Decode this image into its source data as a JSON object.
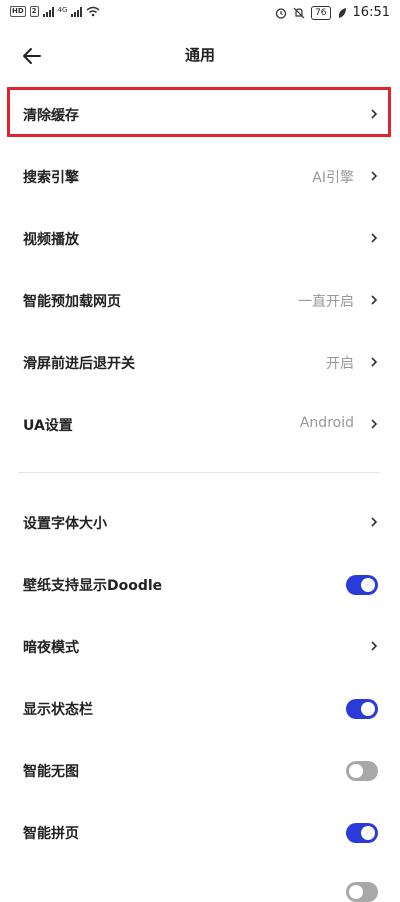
{
  "status_bar": {
    "time": "16:51",
    "battery": "76",
    "network": "4G"
  },
  "header": {
    "title": "通用"
  },
  "colors": {
    "accent": "#2b3bd8",
    "highlight": "#e0242e"
  },
  "settings_group1": [
    {
      "label": "清除缓存",
      "value": "",
      "control": "chevron"
    },
    {
      "label": "搜索引擎",
      "value": "AI引擎",
      "control": "chevron"
    },
    {
      "label": "视频播放",
      "value": "",
      "control": "chevron"
    },
    {
      "label": "智能预加载网页",
      "value": "一直开启",
      "control": "chevron"
    },
    {
      "label": "滑屏前进后退开关",
      "value": "开启",
      "control": "chevron"
    },
    {
      "label": "UA设置",
      "value": "Android",
      "control": "chevron"
    }
  ],
  "settings_group2": [
    {
      "label": "设置字体大小",
      "control": "chevron"
    },
    {
      "label": "壁纸支持显示Doodle",
      "control": "toggle",
      "on": true
    },
    {
      "label": "暗夜模式",
      "control": "chevron"
    },
    {
      "label": "显示状态栏",
      "control": "toggle",
      "on": true
    },
    {
      "label": "智能无图",
      "control": "toggle",
      "on": false
    },
    {
      "label": "智能拼页",
      "control": "toggle",
      "on": true
    }
  ]
}
